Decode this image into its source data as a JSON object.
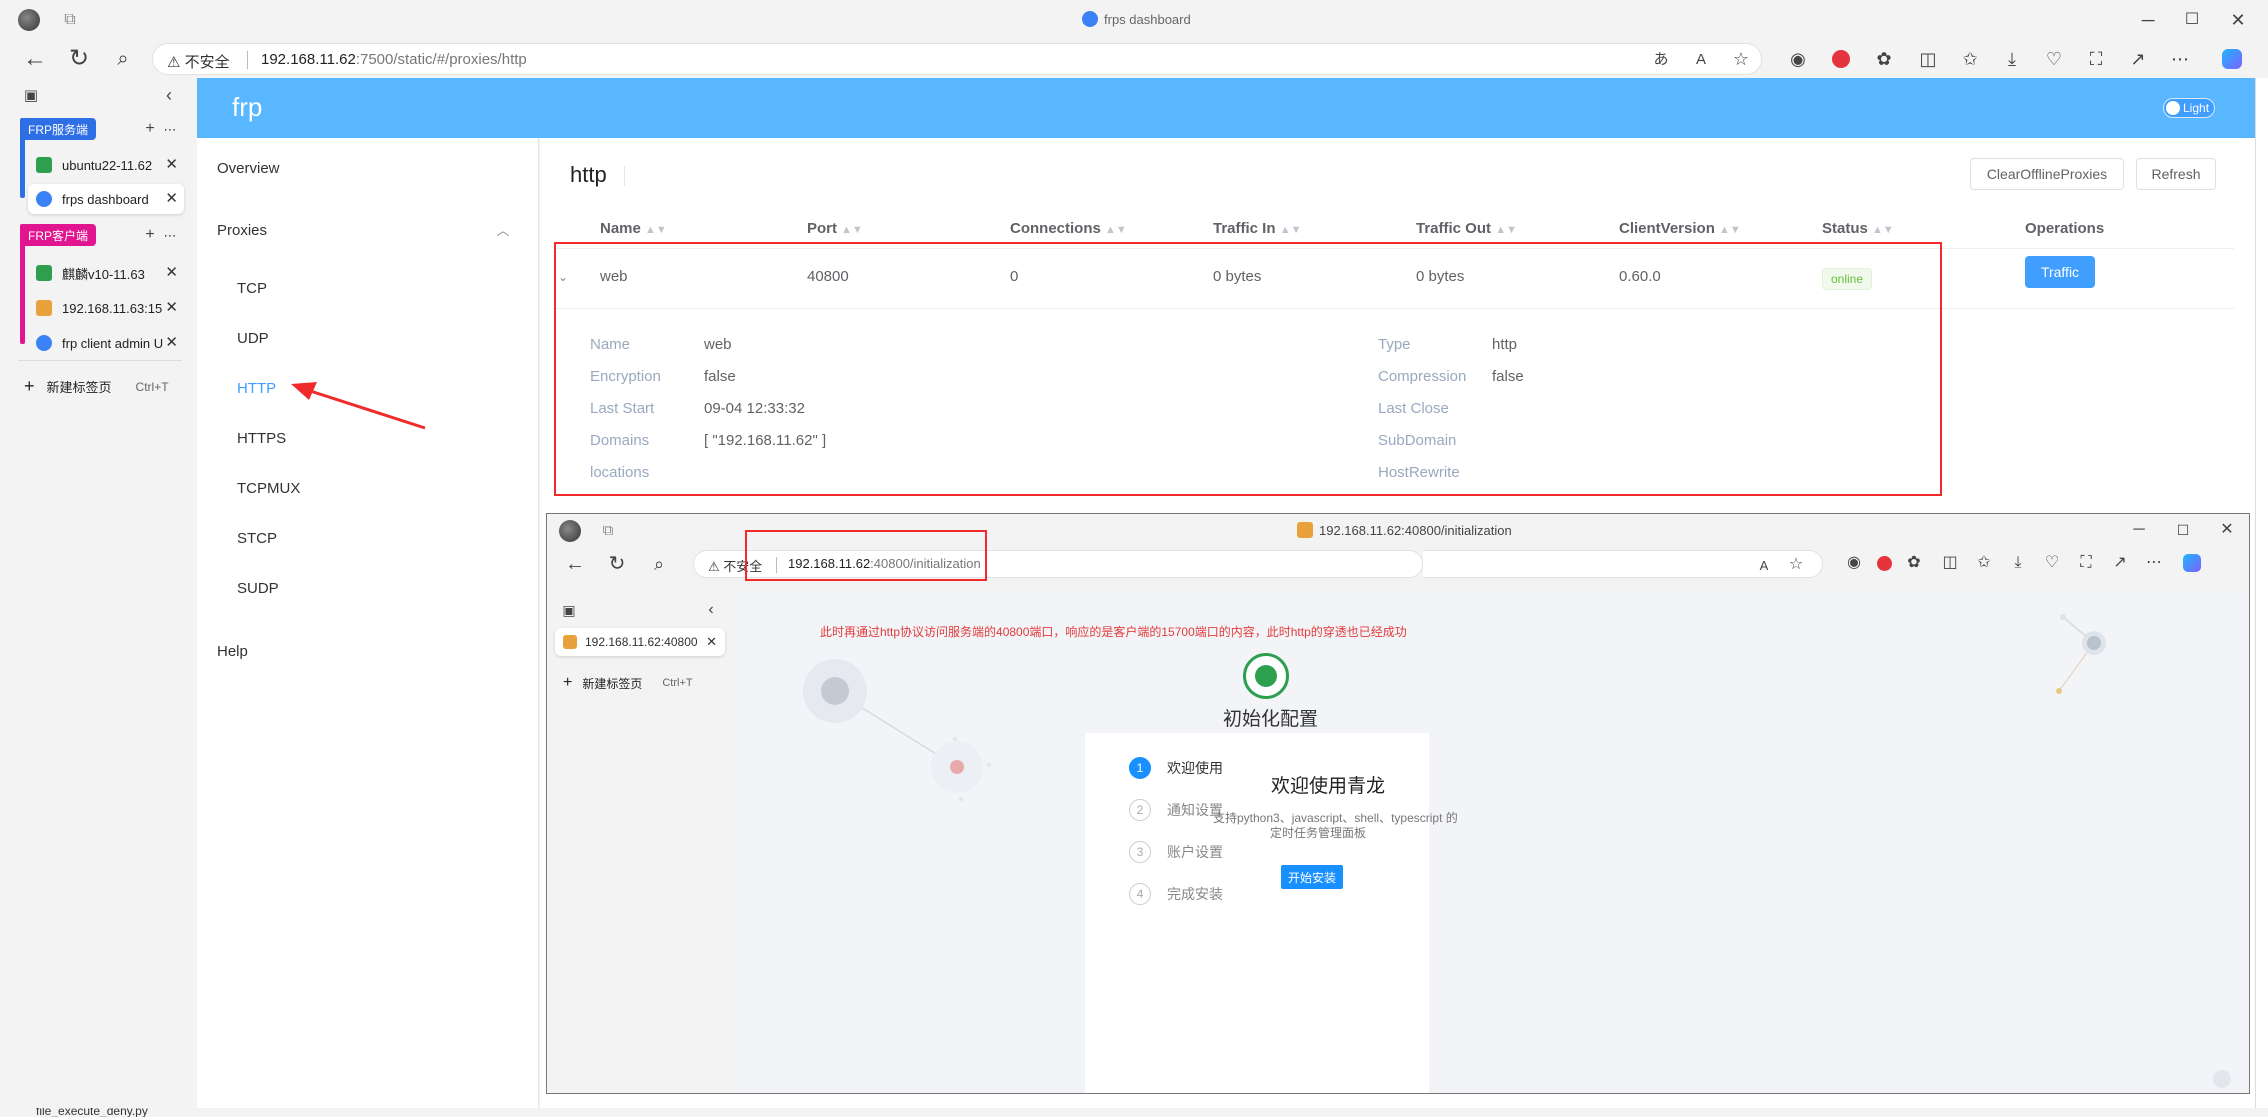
{
  "browser": {
    "title": "frps dashboard",
    "address_security": "不安全",
    "address_host": "192.168.11.62",
    "address_rest": ":7500/static/#/proxies/http"
  },
  "vtabs": {
    "group1": "FRP服务端",
    "group2": "FRP客户端",
    "tabs": [
      "ubuntu22-11.62",
      "frps dashboard",
      "麒麟v10-11.63",
      "192.168.11.63:15",
      "frp client admin U"
    ],
    "new_tab": "新建标签页",
    "new_tab_shortcut": "Ctrl+T"
  },
  "frp": {
    "brand": "frp",
    "theme_toggle": "Light",
    "nav": {
      "overview": "Overview",
      "proxies": "Proxies",
      "items": [
        "TCP",
        "UDP",
        "HTTP",
        "HTTPS",
        "TCPMUX",
        "STCP",
        "SUDP"
      ],
      "help": "Help"
    },
    "page_title": "http",
    "buttons": {
      "clear": "ClearOfflineProxies",
      "refresh": "Refresh",
      "traffic": "Traffic"
    },
    "columns": [
      "Name",
      "Port",
      "Connections",
      "Traffic In",
      "Traffic Out",
      "ClientVersion",
      "Status",
      "Operations"
    ],
    "row": {
      "name": "web",
      "port": "40800",
      "connections": "0",
      "traffic_in": "0 bytes",
      "traffic_out": "0 bytes",
      "client_version": "0.60.0",
      "status": "online"
    },
    "detail": {
      "left_labels": [
        "Name",
        "Encryption",
        "Last Start",
        "Domains",
        "locations"
      ],
      "left_values": [
        "web",
        "false",
        "09-04 12:33:32",
        "[ \"192.168.11.62\" ]",
        ""
      ],
      "right_labels": [
        "Type",
        "Compression",
        "Last Close",
        "SubDomain",
        "HostRewrite"
      ],
      "right_values": [
        "http",
        "false",
        "",
        "",
        ""
      ]
    }
  },
  "inner": {
    "title": "192.168.11.62:40800/initialization",
    "address_security": "不安全",
    "address_host": "192.168.11.62",
    "address_rest": ":40800/initialization",
    "tab_label": "192.168.11.62:40800",
    "new_tab": "新建标签页",
    "new_tab_shortcut": "Ctrl+T",
    "annotation": "此时再通过http协议访问服务端的40800端口，响应的是客户端的15700端口的内容，此时http的穿透也已经成功",
    "heading": "初始化配置",
    "steps": [
      {
        "num": "1",
        "label": "欢迎使用"
      },
      {
        "num": "2",
        "label": "通知设置"
      },
      {
        "num": "3",
        "label": "账户设置"
      },
      {
        "num": "4",
        "label": "完成安装"
      }
    ],
    "welcome_title": "欢迎使用青龙",
    "welcome_desc1": "支持python3、javascript、shell、typescript 的",
    "welcome_desc2": "定时任务管理面板",
    "install_button": "开始安装"
  },
  "taskbar_file": "file_execute_deny.py",
  "colors": {
    "header": "#58b7ff",
    "accent": "#409eff",
    "red": "#ef2b2b",
    "online": "#67c23a",
    "group1": "#2f6fe6",
    "group2": "#e0158f"
  }
}
